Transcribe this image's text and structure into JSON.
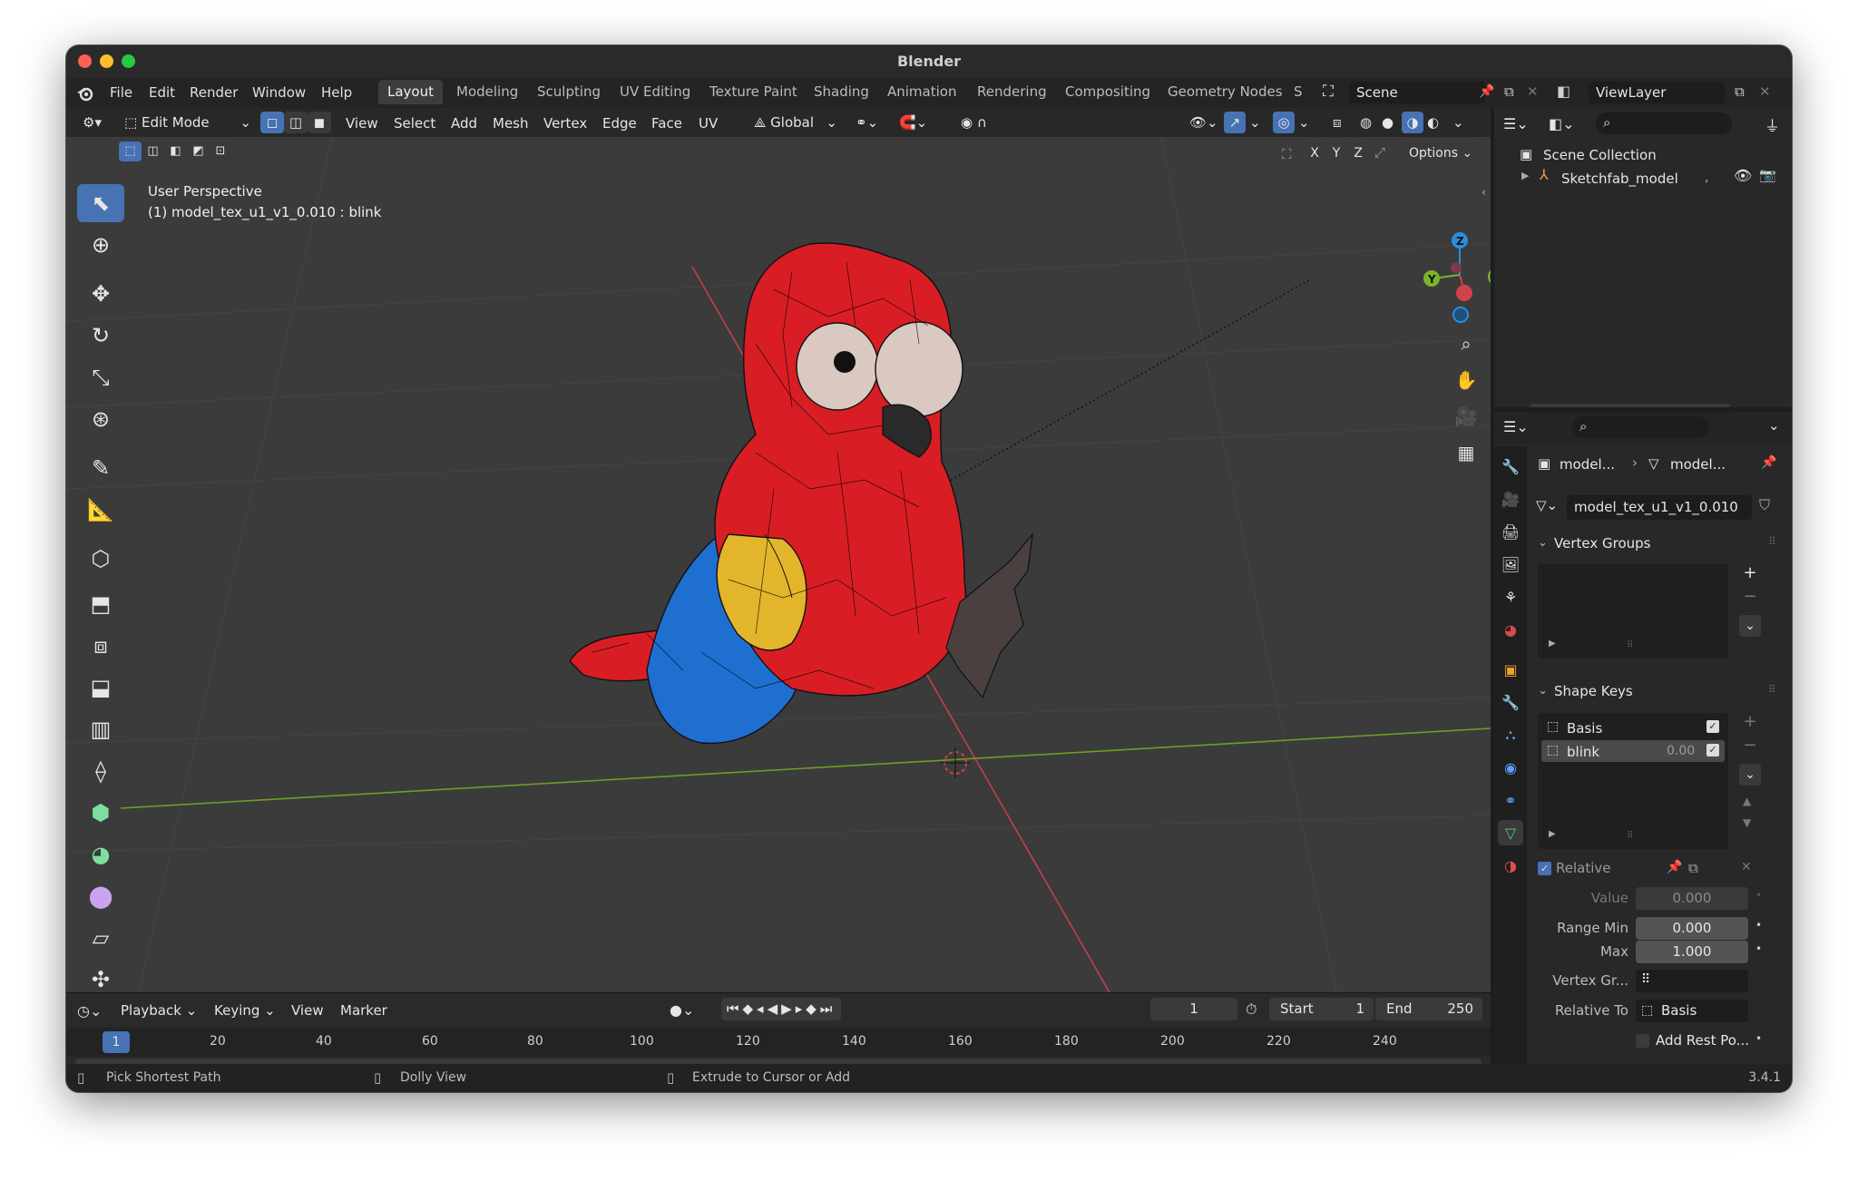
{
  "window": {
    "title": "Blender"
  },
  "menubar": {
    "items": [
      "File",
      "Edit",
      "Render",
      "Window",
      "Help"
    ],
    "workspaces": [
      "Layout",
      "Modeling",
      "Sculpting",
      "UV Editing",
      "Texture Paint",
      "Shading",
      "Animation",
      "Rendering",
      "Compositing",
      "Geometry Nodes",
      "S"
    ],
    "active_workspace": "Layout",
    "scene": "Scene",
    "view_layer": "ViewLayer"
  },
  "viewport_header": {
    "mode": "Edit Mode",
    "menus": [
      "View",
      "Select",
      "Add",
      "Mesh",
      "Vertex",
      "Edge",
      "Face",
      "UV"
    ],
    "transform_orientation": "Global",
    "axes": [
      "X",
      "Y",
      "Z"
    ],
    "options_label": "Options"
  },
  "viewport": {
    "view_name": "User Perspective",
    "object_info": "(1) model_tex_u1_v1_0.010 : blink",
    "gizmo_axes": {
      "z": "Z",
      "y": "Y"
    }
  },
  "timeline": {
    "menus": [
      "Playback",
      "Keying",
      "View",
      "Marker"
    ],
    "current_frame": "1",
    "start_label": "Start",
    "start": "1",
    "end_label": "End",
    "end": "250",
    "ruler": [
      "1",
      "20",
      "40",
      "60",
      "80",
      "100",
      "120",
      "140",
      "160",
      "180",
      "200",
      "220",
      "240"
    ]
  },
  "statusbar": {
    "hints": [
      "Pick Shortest Path",
      "Dolly View",
      "Extrude to Cursor or Add"
    ],
    "version": "3.4.1"
  },
  "outliner": {
    "root": "Scene Collection",
    "items": [
      {
        "name": "Sketchfab_model",
        "extra": ","
      }
    ]
  },
  "properties": {
    "breadcrumb": [
      "model...",
      "model..."
    ],
    "mesh_name": "model_tex_u1_v1_0.010",
    "vertex_groups_title": "Vertex Groups",
    "shape_keys_title": "Shape Keys",
    "shape_keys": [
      {
        "name": "Basis",
        "value": "",
        "checked": true,
        "selected": false
      },
      {
        "name": "blink",
        "value": "0.00",
        "checked": true,
        "selected": true
      }
    ],
    "relative_label": "Relative",
    "value_label": "Value",
    "value": "0.000",
    "range_min_label": "Range Min",
    "range_min": "0.000",
    "max_label": "Max",
    "max": "1.000",
    "vertex_group_label": "Vertex Gr...",
    "relative_to_label": "Relative To",
    "relative_to": "Basis",
    "add_rest_label": "Add Rest Po..."
  },
  "colors": {
    "accent_blue": "#4772b3",
    "x_axis": "#d0424a",
    "y_axis": "#7bb32b",
    "z_axis": "#2a8ee0",
    "parrot_red": "#d81e24",
    "parrot_yellow": "#e3b52b",
    "parrot_blue": "#1f6fd1"
  }
}
